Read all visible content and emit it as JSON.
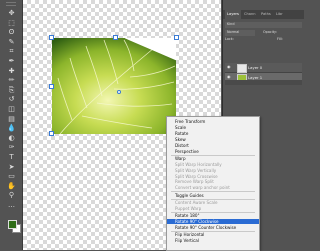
{
  "panel": {
    "tabs": [
      "Layers",
      "Chann",
      "Paths",
      "Libr"
    ],
    "kind_label": "Kind",
    "blend_mode": "Normal",
    "opacity_label": "Opacity:",
    "lock_label": "Lock:",
    "fill_label": "Fill:",
    "layers": [
      {
        "name": "Layer 0",
        "selected": false
      },
      {
        "name": "Layer 1",
        "selected": true
      }
    ]
  },
  "context_menu": {
    "items": [
      {
        "label": "Free Transform",
        "disabled": false,
        "selected": false
      },
      {
        "label": "Scale",
        "disabled": false,
        "selected": false
      },
      {
        "label": "Rotate",
        "disabled": false,
        "selected": false
      },
      {
        "label": "Skew",
        "disabled": false,
        "selected": false
      },
      {
        "label": "Distort",
        "disabled": false,
        "selected": false
      },
      {
        "label": "Perspective",
        "disabled": false,
        "selected": false
      },
      {
        "label": "Warp",
        "disabled": false,
        "selected": false,
        "separator_before": true
      },
      {
        "label": "Split Warp Horizontally",
        "disabled": true,
        "selected": false
      },
      {
        "label": "Split Warp Vertically",
        "disabled": true,
        "selected": false
      },
      {
        "label": "Split Warp Crosswise",
        "disabled": true,
        "selected": false
      },
      {
        "label": "Remove Warp Split",
        "disabled": true,
        "selected": false
      },
      {
        "label": "Convert warp anchor point",
        "disabled": true,
        "selected": false
      },
      {
        "label": "Toggle Guides",
        "disabled": false,
        "selected": false,
        "separator_before": true
      },
      {
        "label": "Content Aware Scale",
        "disabled": true,
        "selected": false,
        "separator_before": true
      },
      {
        "label": "Puppet Warp",
        "disabled": true,
        "selected": false
      },
      {
        "label": "Rotate 180°",
        "disabled": false,
        "selected": false,
        "separator_before": true
      },
      {
        "label": "Rotate 90° Clockwise",
        "disabled": false,
        "selected": true
      },
      {
        "label": "Rotate 90° Counter Clockwise",
        "disabled": false,
        "selected": false
      },
      {
        "label": "Flip Horizontal",
        "disabled": false,
        "selected": false,
        "separator_before": true
      },
      {
        "label": "Flip Vertical",
        "disabled": false,
        "selected": false
      }
    ]
  },
  "toolbar": {
    "tools": [
      "move-tool",
      "marquee-tool",
      "lasso-tool",
      "quick-select-tool",
      "crop-tool",
      "eyedropper-tool",
      "healing-tool",
      "brush-tool",
      "clone-stamp-tool",
      "history-brush-tool",
      "eraser-tool",
      "gradient-tool",
      "blur-tool",
      "dodge-tool",
      "pen-tool",
      "type-tool",
      "path-select-tool",
      "rectangle-tool",
      "hand-tool",
      "zoom-tool",
      "more-tools"
    ]
  },
  "colors": {
    "foreground": "#2f6d18",
    "background": "#ffffff",
    "menu_highlight": "#2a6bd3"
  }
}
